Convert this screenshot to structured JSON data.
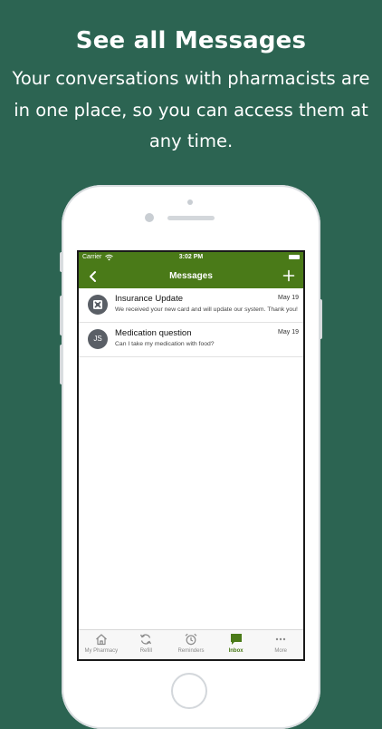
{
  "promo": {
    "headline": "See all Messages",
    "subline_1": "Your conversations with pharmacists are",
    "subline_2": "in one place, so you can access them at",
    "subline_3": "any time."
  },
  "status_bar": {
    "carrier": "Carrier",
    "time": "3:02 PM"
  },
  "nav": {
    "title": "Messages",
    "back_icon": "chevron-left-icon",
    "add_icon": "plus-icon"
  },
  "messages": [
    {
      "title": "Insurance Update",
      "date": "May 19",
      "preview": "We received your new card and will update our system. Thank you!",
      "avatar_icon": "pharmacy-icon",
      "avatar_text": ""
    },
    {
      "title": "Medication question",
      "date": "May 19",
      "preview": "Can I take my medication with food?",
      "avatar_icon": "",
      "avatar_text": "JS"
    }
  ],
  "tabs": [
    {
      "label": "My Pharmacy",
      "icon": "home-icon",
      "active": false
    },
    {
      "label": "Refill",
      "icon": "refresh-icon",
      "active": false
    },
    {
      "label": "Reminders",
      "icon": "alarm-clock-icon",
      "active": false
    },
    {
      "label": "Inbox",
      "icon": "chat-bubble-icon",
      "active": true
    },
    {
      "label": "More",
      "icon": "more-icon",
      "active": false
    }
  ],
  "colors": {
    "background": "#2c6452",
    "brand_green": "#4a7a18",
    "avatar": "#5a5f66",
    "tab_inactive": "#8a8a8a"
  }
}
